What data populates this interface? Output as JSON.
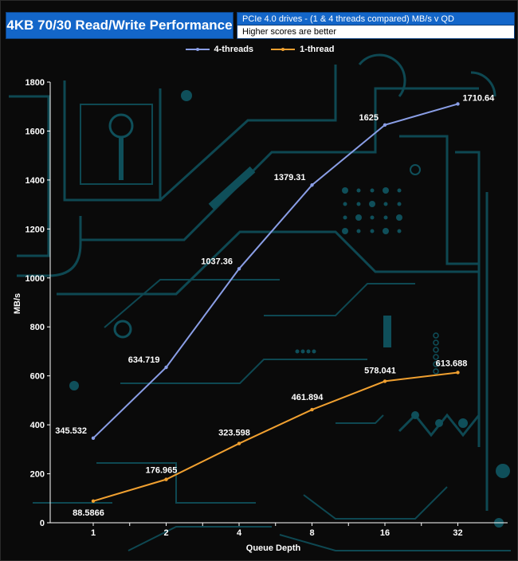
{
  "title": "4KB 70/30 Read/Write Performance",
  "subtitle": "PCIe 4.0 drives - (1 & 4 threads compared) MB/s v QD",
  "note": "Higher scores are better",
  "colors": {
    "title_bg": "#1366c9",
    "series_4threads": "#8a9ee6",
    "series_1thread": "#f0a030",
    "circuit": "#0f4f5a"
  },
  "chart_data": {
    "type": "line",
    "title": "4KB 70/30 Read/Write Performance",
    "xlabel": "Queue Depth",
    "ylabel": "MB/s",
    "categories": [
      "1",
      "2",
      "4",
      "8",
      "16",
      "32"
    ],
    "ylim": [
      0,
      1800
    ],
    "yticks": [
      0,
      200,
      400,
      600,
      800,
      1000,
      1200,
      1400,
      1600,
      1800
    ],
    "legend_position": "top-center",
    "grid": false,
    "series": [
      {
        "name": "4-threads",
        "color": "#8a9ee6",
        "values": [
          345.532,
          634.719,
          1037.36,
          1379.31,
          1625,
          1710.64
        ],
        "labels": [
          "345.532",
          "634.719",
          "1037.36",
          "1379.31",
          "1625",
          "1710.64"
        ]
      },
      {
        "name": "1-thread",
        "color": "#f0a030",
        "values": [
          88.5866,
          176.965,
          323.598,
          461.894,
          578.041,
          613.688
        ],
        "labels": [
          "88.5866",
          "176.965",
          "323.598",
          "461.894",
          "578.041",
          "613.688"
        ]
      }
    ]
  }
}
